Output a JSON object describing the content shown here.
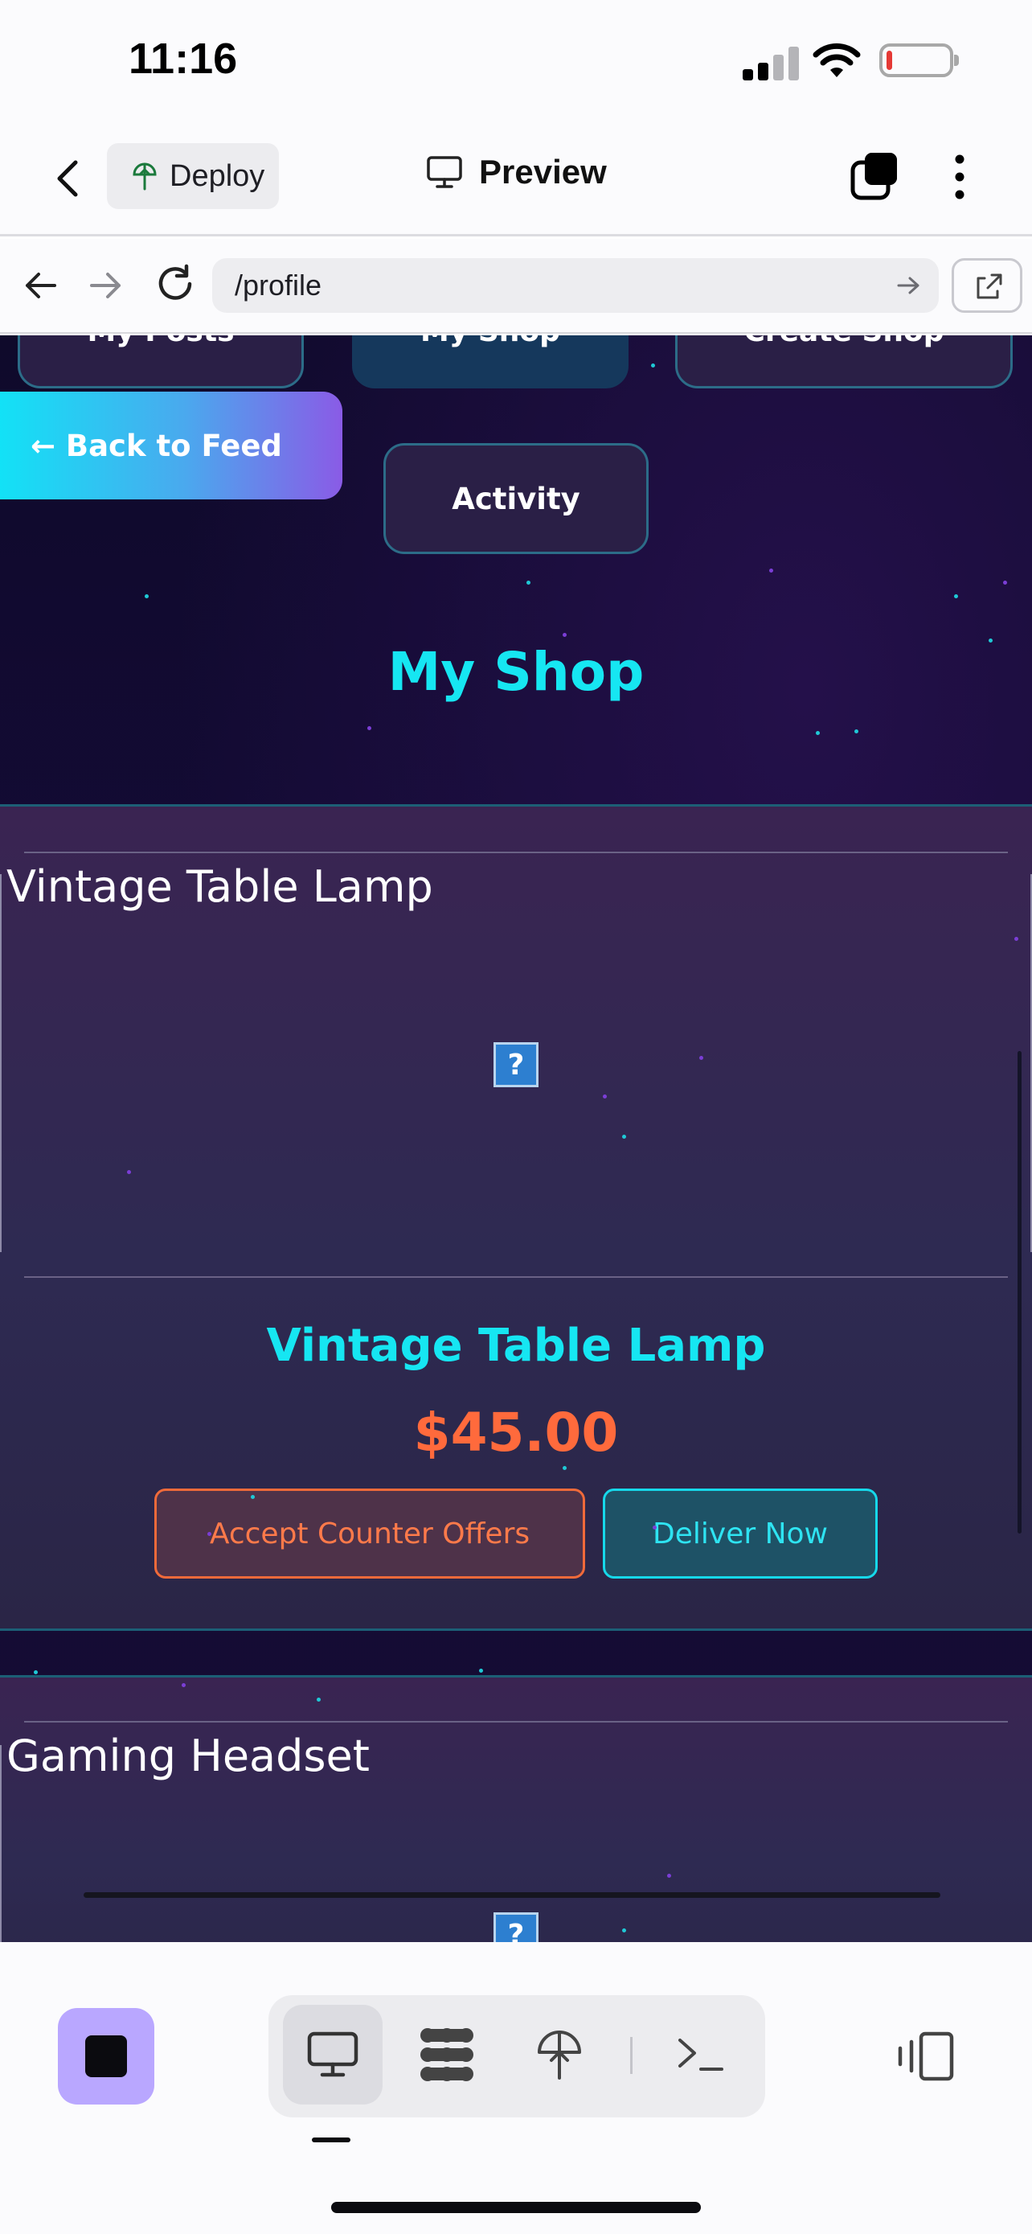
{
  "status_bar": {
    "time": "11:16",
    "battery_level": 0.1,
    "battery_color": "#e53935"
  },
  "header": {
    "deploy_label": "Deploy",
    "preview_label": "Preview",
    "icons": [
      "chevron-left-icon",
      "deploy-icon",
      "monitor-icon",
      "tabs-icon",
      "more-vertical-icon"
    ]
  },
  "browser": {
    "url": "/profile",
    "icons": [
      "arrow-left-icon",
      "arrow-right-icon",
      "reload-icon",
      "url-go-icon",
      "open-external-icon"
    ]
  },
  "page": {
    "nav_buttons": [
      {
        "label": "My Posts",
        "active": false
      },
      {
        "label": "My Shop",
        "active": true
      },
      {
        "label": "Create Shop",
        "active": false
      }
    ],
    "back_to_feed": "← Back to Feed",
    "activity": "Activity",
    "section_title": "My Shop",
    "colors": {
      "accent_cyan": "#16e6f2",
      "price_orange": "#ff6a3c"
    },
    "products": [
      {
        "image_alt": "Vintage Table Lamp",
        "broken_image_glyph": "?",
        "name": "Vintage Table Lamp",
        "price": "$45.00",
        "accept_label": "Accept Counter Offers",
        "deliver_label": "Deliver Now"
      },
      {
        "image_alt": "Gaming Headset",
        "broken_image_glyph": "?"
      }
    ]
  },
  "toolbar": {
    "tools": [
      "preview-tool-icon",
      "workspace-tool-icon",
      "deploy-tool-icon",
      "console-tool-icon"
    ],
    "selected_tool": "preview-tool-icon",
    "stop_icon": "stop-icon",
    "devices_icon": "devices-icon"
  }
}
